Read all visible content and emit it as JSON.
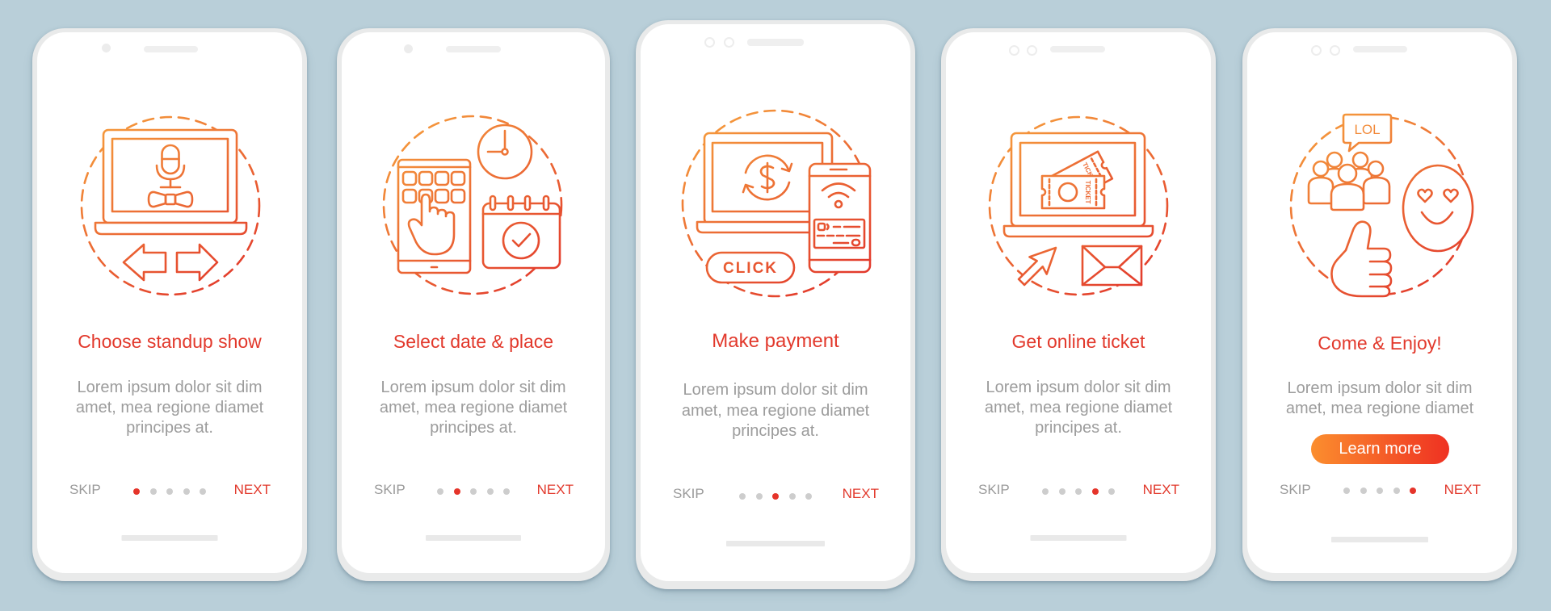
{
  "theme": {
    "background": "#b9cfd9",
    "accent_red": "#e2392c",
    "accent_orange": "#f59a3c",
    "text_grey": "#9c9c9c",
    "dot_inactive": "#cdcdcd",
    "dot_active": "#e5342a",
    "button_gradient": [
      "#fb8e2e",
      "#ef3122"
    ]
  },
  "screens": [
    {
      "title": "Choose standup show",
      "body_lines": [
        "Lorem ipsum dolor sit dim",
        "amet, mea regione diamet",
        "principes at."
      ],
      "skip_label": "SKIP",
      "next_label": "NEXT",
      "active_step": 1,
      "step_count": 5,
      "illustration": {
        "name": "laptop-microphone-bowtie-arrows"
      }
    },
    {
      "title": "Select date & place",
      "body_lines": [
        "Lorem ipsum dolor sit dim",
        "amet, mea regione diamet",
        "principes at."
      ],
      "skip_label": "SKIP",
      "next_label": "NEXT",
      "active_step": 2,
      "step_count": 5,
      "illustration": {
        "name": "tablet-hand-clock-calendar"
      }
    },
    {
      "title": "Make payment",
      "body_lines": [
        "Lorem ipsum dolor sit dim",
        "amet, mea regione diamet",
        "principes at."
      ],
      "skip_label": "SKIP",
      "next_label": "NEXT",
      "active_step": 3,
      "step_count": 5,
      "illustration": {
        "name": "laptop-dollar-phone-card",
        "button_text": "CLICK"
      }
    },
    {
      "title": "Get online ticket",
      "body_lines": [
        "Lorem ipsum dolor sit dim",
        "amet, mea regione diamet",
        "principes at."
      ],
      "skip_label": "SKIP",
      "next_label": "NEXT",
      "active_step": 4,
      "step_count": 5,
      "illustration": {
        "name": "laptop-ticket-cursor-envelope",
        "ticket_text": "TICKET"
      }
    },
    {
      "title": "Come & Enjoy!",
      "body_lines": [
        "Lorem ipsum dolor sit dim",
        "amet, mea regione diamet"
      ],
      "cta_label": "Learn more",
      "skip_label": "SKIP",
      "next_label": "NEXT",
      "active_step": 5,
      "step_count": 5,
      "illustration": {
        "name": "audience-smiley-thumbs-up",
        "bubble_text": "LOL"
      }
    }
  ]
}
